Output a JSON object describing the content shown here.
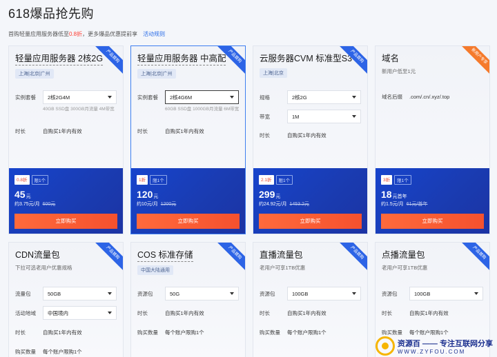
{
  "page": {
    "title": "618爆品抢先购",
    "subtitle_pre": "首购轻量应用服务器低至",
    "subtitle_highlight": "0.8折",
    "subtitle_post": "，更多爆品优惠提前享",
    "subtitle_link": "活动规则"
  },
  "cards": [
    {
      "name": "轻量应用服务器 2核2G",
      "ribbon": "产品首购",
      "region": "上海|北京|广州",
      "spec_label": "实例套餐",
      "spec_value": "2核2G4M",
      "spec_note": "40GB SSD盘 300GB月流量 4M带宽",
      "duration_label": "时长",
      "duration_value": "自购买1年内有效",
      "discount": "0.8折",
      "limit": "限1个",
      "price": "45",
      "price_unit": "元",
      "per_month": "约3.75元/月",
      "original": "600元",
      "buy_label": "立即购买"
    },
    {
      "name": "轻量应用服务器 中高配",
      "ribbon": "产品首购",
      "region": "上海|北京|广州",
      "spec_label": "实例套餐",
      "spec_value": "2核4G6M",
      "spec_note": "60GB SSD盘 1000GB月流量 6M带宽",
      "duration_label": "时长",
      "duration_value": "自购买1年内有效",
      "discount": "1折",
      "limit": "限1个",
      "price": "120",
      "price_unit": "元",
      "per_month": "约10元/月",
      "original": "1200元",
      "buy_label": "立即购买"
    },
    {
      "name": "云服务器CVM 标准型S3",
      "ribbon": "产品首购",
      "region": "上海|北京",
      "spec_label": "规格",
      "spec_value": "2核2G",
      "bandwidth_label": "带宽",
      "bandwidth_value": "1M",
      "duration_label": "时长",
      "duration_value": "自购买1年内有效",
      "discount": "2.1折",
      "limit": "限1个",
      "price": "299",
      "price_unit": "元",
      "per_month": "约24.92元/月",
      "original": "1453.2元",
      "buy_label": "立即购买"
    },
    {
      "name": "域名",
      "ribbon": "新用户专享",
      "desc": "新用户低至1元",
      "suffix_label": "域名后缀",
      "suffix_value": ".com/.cn/.xyz/.top",
      "discount": "3折",
      "limit": "限1个",
      "price": "18",
      "price_unit": "元首年",
      "per_month": "约1.5元/月",
      "original": "61元/首年",
      "buy_label": "立即购买"
    },
    {
      "name": "CDN流量包",
      "ribbon": "产品首购",
      "desc": "下拉可选老用户优惠规格",
      "pkg_label": "流量包",
      "pkg_value": "50GB",
      "area_label": "活动地域",
      "area_value": "中国境内",
      "duration_label": "时长",
      "duration_value": "自购买1年内有效",
      "qty_label": "购买数量",
      "qty_value": "每个账户限购1个"
    },
    {
      "name": "COS 标准存储",
      "ribbon": "产品首购",
      "region": "中国大陆通用",
      "pkg_label": "资源包",
      "pkg_value": "50G",
      "duration_label": "时长",
      "duration_value": "自购买1年内有效",
      "qty_label": "购买数量",
      "qty_value": "每个账户限购1个"
    },
    {
      "name": "直播流量包",
      "ribbon": "产品首购",
      "desc": "老用户可享1TB优惠",
      "pkg_label": "资源包",
      "pkg_value": "100GB",
      "duration_label": "时长",
      "duration_value": "自购买1年内有效",
      "qty_label": "购买数量",
      "qty_value": "每个账户限购1个"
    },
    {
      "name": "点播流量包",
      "ribbon": "产品首购",
      "desc": "老用户可享1TB优惠",
      "pkg_label": "资源包",
      "pkg_value": "100GB",
      "duration_label": "时长",
      "duration_value": "自购买1年内有效",
      "qty_label": "购买数量",
      "qty_value": "每个账户限购1个"
    }
  ],
  "watermark": {
    "line1": "资源百 —— 专注互联网分享",
    "line2": "WWW.ZYFOU.COM"
  },
  "colors": {
    "accent_blue": "#2d64e6",
    "price_bg": "#1a3bb0",
    "buy_orange": "#f5512e",
    "highlight_red": "#ff3b30"
  }
}
